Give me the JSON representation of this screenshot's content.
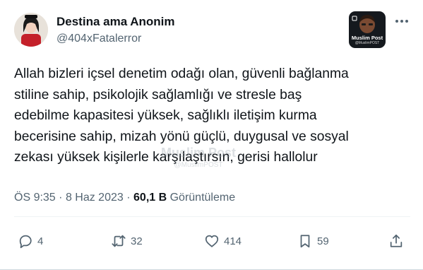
{
  "author": {
    "display_name": "Destina ama Anonim",
    "handle": "@404xFatalerror",
    "avatar_icon": "avatar-photo"
  },
  "watermark": {
    "title": "Muslim Post",
    "handle": "@MuslimPOST"
  },
  "more_icon": "more-horizontal-icon",
  "tweet": {
    "lines": [
      "Allah bizleri içsel denetim odağı olan, güvenli bağlanma",
      "stiline sahip, psikolojik sağlamlığı ve stresle baş",
      "edebilme kapasitesi yüksek, sağlıklı iletişim kurma",
      "becerisine sahip, mizah yönü güçlü, duygusal ve sosyal",
      "zekası yüksek kişilerle karşılaştırsın, gerisi  hallolur"
    ]
  },
  "meta": {
    "time": "ÖS 9:35",
    "separator": "·",
    "date": "8 Haz 2023",
    "views_count": "60,1 B",
    "views_label": "Görüntüleme"
  },
  "actions": {
    "reply": {
      "icon": "reply-icon",
      "count": "4"
    },
    "retweet": {
      "icon": "retweet-icon",
      "count": "32"
    },
    "like": {
      "icon": "heart-icon",
      "count": "414"
    },
    "bookmark": {
      "icon": "bookmark-icon",
      "count": "59"
    },
    "share": {
      "icon": "share-icon"
    }
  },
  "colors": {
    "text": "#0f1419",
    "secondary": "#536471"
  }
}
